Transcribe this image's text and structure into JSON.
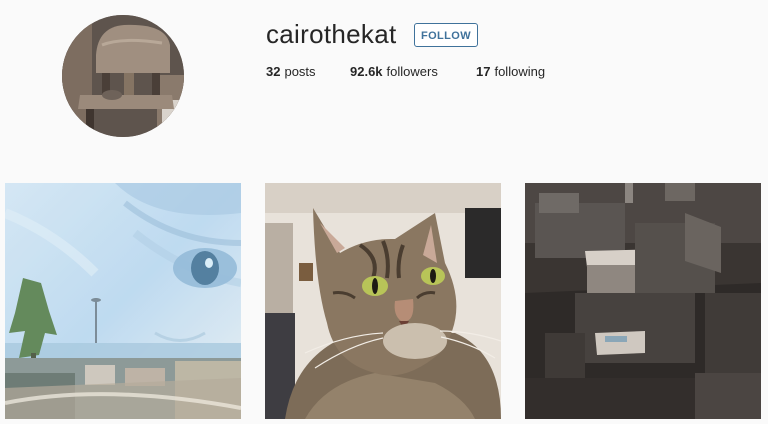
{
  "profile": {
    "username": "cairothekat",
    "follow_label": "FOLLOW",
    "posts": {
      "count": "32",
      "label": "posts"
    },
    "followers": {
      "count": "92.6k",
      "label": "followers"
    },
    "following": {
      "count": "17",
      "label": "following"
    }
  },
  "posts": [
    {
      "subject": "double exposure of cat face over city skyline"
    },
    {
      "subject": "tabby cat portrait"
    },
    {
      "subject": "room with cardboard boxes"
    }
  ],
  "colors": {
    "background": "#fafafa",
    "follow_blue": "#3f729b",
    "text": "#262626"
  }
}
